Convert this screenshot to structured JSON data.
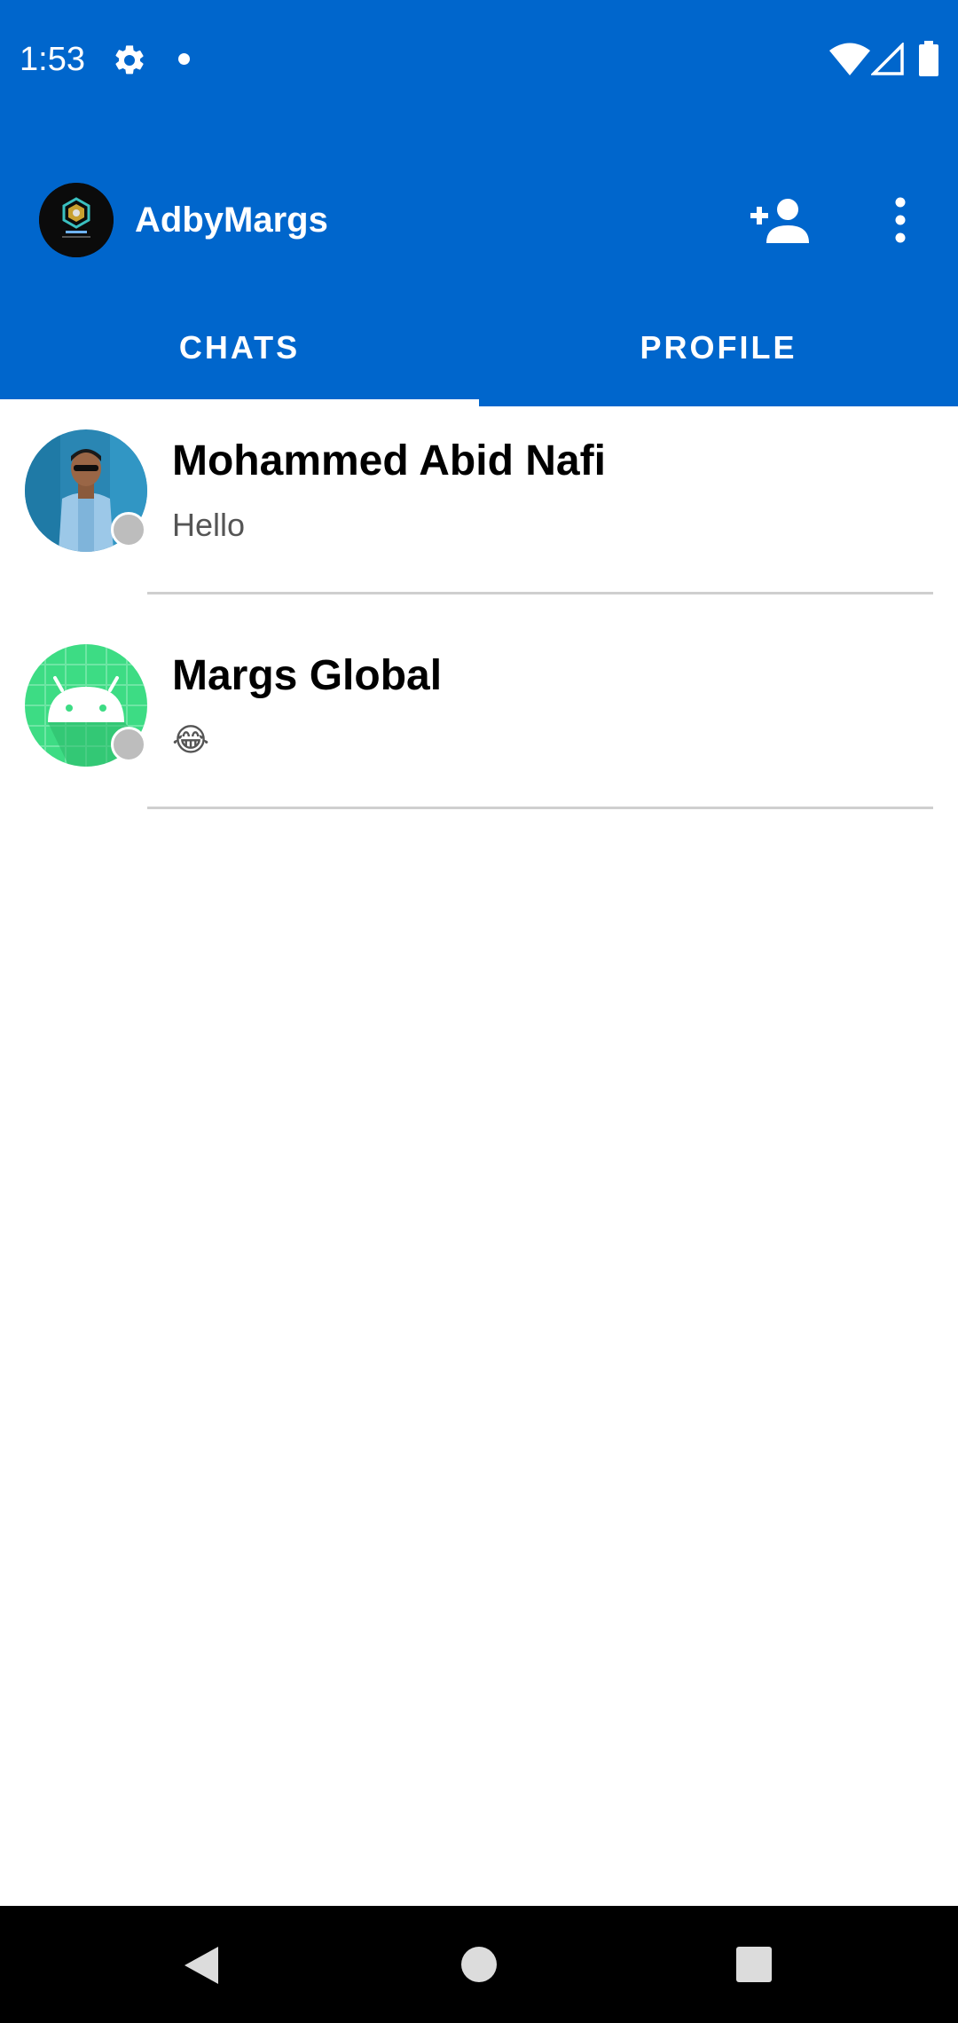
{
  "status_bar": {
    "time": "1:53"
  },
  "toolbar": {
    "title": "AdbyMargs"
  },
  "tabs": [
    {
      "label": "CHATS",
      "selected": true
    },
    {
      "label": "PROFILE",
      "selected": false
    }
  ],
  "chats": [
    {
      "name": "Mohammed Abid Nafi",
      "last_message": "Hello",
      "online": false
    },
    {
      "name": "Margs Global",
      "last_message": "😂",
      "online": false
    }
  ],
  "colors": {
    "primary": "#0066CC",
    "presence_offline": "#BDBDBD",
    "android_green": "#3DDC84"
  },
  "icons": {
    "status": [
      "settings-icon",
      "notification-dot-icon",
      "wifi-icon",
      "signal-icon",
      "battery-icon"
    ],
    "toolbar": [
      "add-person-icon",
      "overflow-menu-icon"
    ],
    "nav": [
      "back-icon",
      "home-icon",
      "recents-icon"
    ]
  }
}
